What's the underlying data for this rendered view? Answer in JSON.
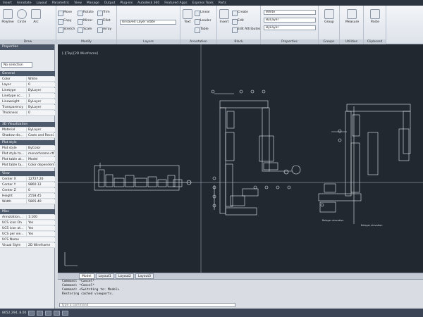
{
  "menu": {
    "items": [
      "Insert",
      "Annotate",
      "Layout",
      "Parametric",
      "View",
      "Manage",
      "Output",
      "Plug-ins",
      "Autodesk 360",
      "Featured Apps",
      "Express Tools",
      "Parts"
    ]
  },
  "ribbon": {
    "draw": {
      "title": "Draw",
      "polyline": "Polyline",
      "circle": "Circle",
      "arc": "Arc"
    },
    "modify": {
      "title": "Modify",
      "move": "Move",
      "rotate": "Rotate",
      "trim": "Trim",
      "copy": "Copy",
      "mirror": "Mirror",
      "fillet": "Fillet",
      "stretch": "Stretch",
      "scale": "Scale",
      "array": "Array"
    },
    "layers": {
      "title": "Layers",
      "state": "Unsaved Layer State"
    },
    "annotation": {
      "title": "Annotation",
      "text": "Text",
      "linear": "Linear",
      "leader": "Leader",
      "table": "Table"
    },
    "block": {
      "title": "Block",
      "insert": "Insert",
      "create": "Create",
      "edit": "Edit",
      "edit_attributes": "Edit Attributes"
    },
    "properties": {
      "title": "Properties",
      "color": "White",
      "linetype": "ByLayer",
      "lineweight": "ByLayer"
    },
    "groups": {
      "title": "Groups",
      "group": "Group"
    },
    "utilities": {
      "title": "Utilities",
      "measure": "Measure"
    },
    "clipboard": {
      "title": "Clipboard",
      "paste": "Paste"
    }
  },
  "properties_palette": {
    "title": "Properties",
    "selection": "No selection",
    "sections": {
      "general": "General",
      "viz3d": "3D Visualization",
      "plot": "Plot style",
      "view": "View",
      "misc": "Misc"
    },
    "general": [
      {
        "name": "Color",
        "value": "White"
      },
      {
        "name": "Layer",
        "value": "0"
      },
      {
        "name": "Linetype",
        "value": "ByLayer"
      },
      {
        "name": "Linetype sc...",
        "value": "1"
      },
      {
        "name": "Lineweight",
        "value": "ByLayer"
      },
      {
        "name": "Transparency",
        "value": "ByLayer"
      },
      {
        "name": "Thickness",
        "value": "0"
      }
    ],
    "viz3d": [
      {
        "name": "Material",
        "value": "ByLayer"
      },
      {
        "name": "Shadow dis...",
        "value": "Casts and Recei..."
      }
    ],
    "plot": [
      {
        "name": "Plot style",
        "value": "ByColor"
      },
      {
        "name": "Plot style ta...",
        "value": "monochrome.ctb"
      },
      {
        "name": "Plot table at...",
        "value": "Model"
      },
      {
        "name": "Plot table ty...",
        "value": "Color dependent"
      }
    ],
    "view": [
      {
        "name": "Center X",
        "value": "12727.26"
      },
      {
        "name": "Center Y",
        "value": "9860.12"
      },
      {
        "name": "Center Z",
        "value": "0"
      },
      {
        "name": "Height",
        "value": "2558.45"
      },
      {
        "name": "Width",
        "value": "5805.40"
      }
    ],
    "misc": [
      {
        "name": "Annotation...",
        "value": "1:100"
      },
      {
        "name": "UCS icon On",
        "value": "Yes"
      },
      {
        "name": "UCS icon at...",
        "value": "Yes"
      },
      {
        "name": "UCS per vie...",
        "value": "Yes"
      },
      {
        "name": "UCS Name",
        "value": ""
      },
      {
        "name": "Visual Style",
        "value": "2D Wireframe"
      }
    ]
  },
  "viewport": {
    "label": "[-][Top][2D Wireframe]",
    "annotation_left": "Belsger elevation",
    "annotation_right": "Belsger elevation"
  },
  "layout_tabs": [
    "Model",
    "Layout1",
    "Layout2",
    "Layout3"
  ],
  "command": {
    "lines": [
      "Command: *Cancel*",
      "Command: *Cancel*",
      "Command:  <Switching to: Model>",
      "Restoring cached viewports."
    ],
    "placeholder": "Type a command"
  },
  "status": {
    "coords": "8652.294, 8.00"
  },
  "colors": {
    "canvas": "#212830",
    "drawing": "#e6ebef",
    "crosshair": "#b9c2cc",
    "titlebar": "#2c3440"
  }
}
